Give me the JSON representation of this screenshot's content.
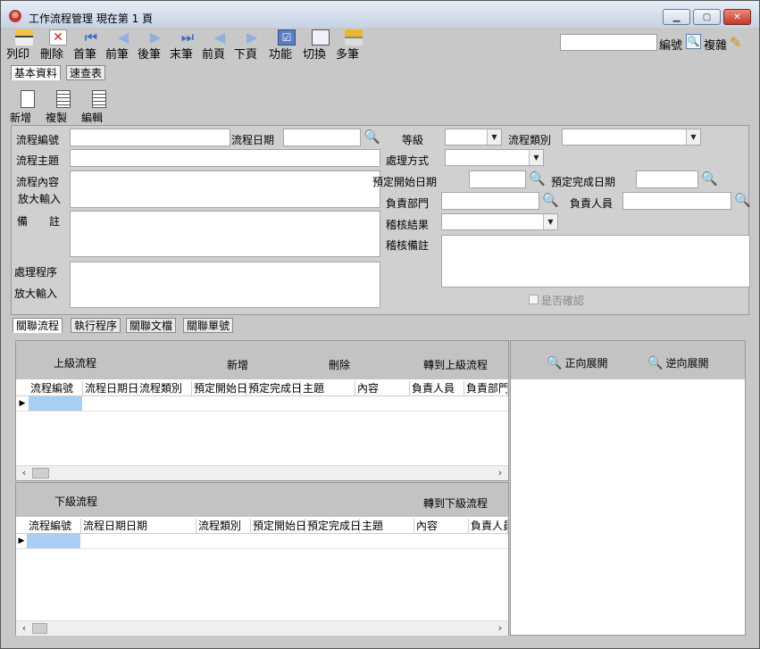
{
  "window": {
    "title": "工作流程管理 現在第 1 頁"
  },
  "toolbar": {
    "print": "列印",
    "delete": "刪除",
    "first": "首筆",
    "prev": "前筆",
    "next": "後筆",
    "last": "末筆",
    "prev_page": "前頁",
    "next_page": "下頁",
    "function": "功能",
    "switch": "切換",
    "multi": "多筆"
  },
  "search": {
    "value": "",
    "label": "編號",
    "complex_label": "複雜"
  },
  "main_tabs": [
    "基本資料",
    "速查表"
  ],
  "record_toolbar": {
    "add": "新增",
    "copy": "複製",
    "edit": "編輯"
  },
  "form": {
    "flow_no": "流程編號",
    "flow_date": "流程日期",
    "grade": "等級",
    "flow_type": "流程類別",
    "flow_subject": "流程主題",
    "handling_method": "處理方式",
    "flow_content": "流程內容",
    "enlarge": "放大輸入",
    "planned_start": "預定開始日期",
    "planned_finish": "預定完成日期",
    "remarks_1": "備",
    "remarks_2": "註",
    "resp_dept": "負責部門",
    "resp_person": "負責人員",
    "audit_result": "稽核結果",
    "audit_note": "稽核備註",
    "process_seq": "處理程序",
    "enlarge_2": "放大輸入",
    "confirmed": "是否確認"
  },
  "detail_tabs": [
    "關聯流程",
    "執行程序",
    "關聯文檔",
    "關聯單號"
  ],
  "upper": {
    "title": "上級流程",
    "add": "新增",
    "delete": "刪除",
    "goto": "轉到上級流程",
    "columns": [
      "流程編號",
      "流程日期日",
      "流程類別",
      "預定開始日",
      "預定完成日",
      "主題",
      "內容",
      "負責人員",
      "負責部門"
    ]
  },
  "lower": {
    "title": "下級流程",
    "goto": "轉到下級流程",
    "columns": [
      "流程編號",
      "流程日期日期",
      "流程類別",
      "預定開始日",
      "預定完成日",
      "主題",
      "內容",
      "負責人員"
    ]
  },
  "right_panel": {
    "expand_forward": "正向展開",
    "expand_backward": "逆向展開"
  }
}
